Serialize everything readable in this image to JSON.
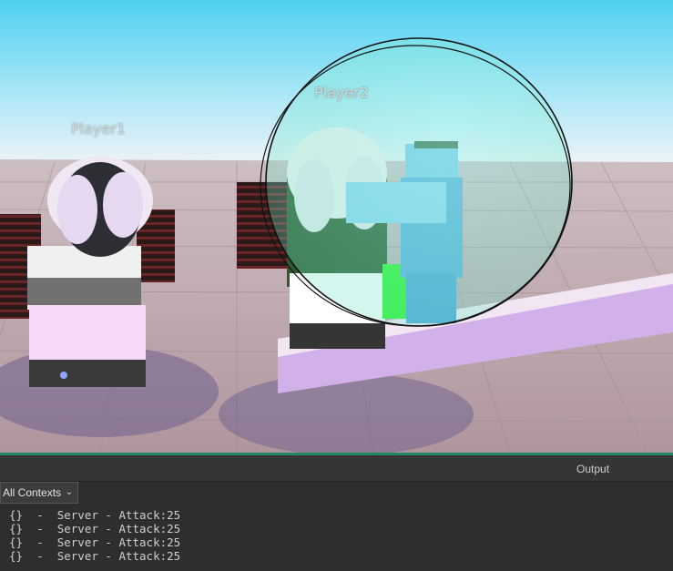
{
  "viewport": {
    "players": [
      {
        "name_tag": "Player1"
      },
      {
        "name_tag": "Player2"
      }
    ],
    "colors": {
      "sky_top": "#53d2f2",
      "sky_bottom": "#eaf4fb",
      "ground": "#b79aa0",
      "force_field": "#7ef0d8",
      "platform": "#d6b4ec"
    }
  },
  "output_panel": {
    "title": "Output",
    "context_filter": "All Contexts",
    "logs": [
      {
        "prefix": "{}",
        "separator": "-",
        "message": "Server - Attack:25"
      },
      {
        "prefix": "{}",
        "separator": "-",
        "message": "Server - Attack:25"
      },
      {
        "prefix": "{}",
        "separator": "-",
        "message": "Server - Attack:25"
      },
      {
        "prefix": "{}",
        "separator": "-",
        "message": "Server - Attack:25"
      }
    ]
  }
}
